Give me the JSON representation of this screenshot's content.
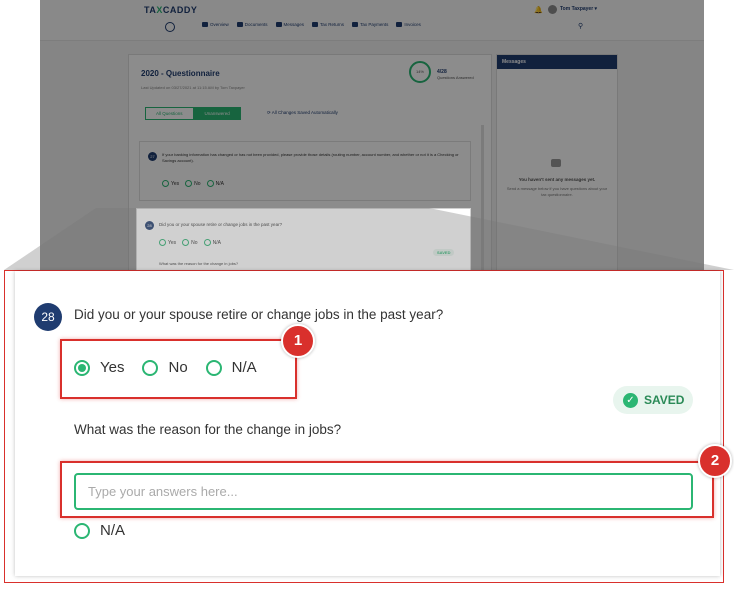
{
  "app": {
    "logo_pre": "TA",
    "logo_x": "X",
    "logo_post": "CADDY",
    "user_name": "Tom Taxpayer ▾"
  },
  "nav": {
    "items": [
      "Overview",
      "Documents",
      "Messages",
      "Tax Returns",
      "Tax Payments",
      "Invoices"
    ]
  },
  "questionnaire": {
    "title": "2020 - Questionnaire",
    "last_updated": "Last Updated on 03/27/2021 at 11:15 AM by Tom Taxpayer",
    "progress_percent_label": "14%",
    "answered_count": "4/28",
    "answered_label": "Questions Answered",
    "tabs": [
      "All Questions",
      "Unanswered"
    ],
    "autosave_text": "All Changes Saved Automatically"
  },
  "question27": {
    "number": "27",
    "text": "If your banking information has changed or has not been provided, please provide those details (routing number, account number, and whether or not it is a Checking or Savings account).",
    "options": [
      "Yes",
      "No",
      "N/A"
    ]
  },
  "messages": {
    "header": "Messages",
    "empty_title": "You haven't sent any messages yet.",
    "empty_sub": "Send a message below if you have questions about your tax questionnaire."
  },
  "question28": {
    "number": "28",
    "text": "Did you or your spouse retire or change jobs in the past year?",
    "options": [
      "Yes",
      "No",
      "N/A"
    ],
    "selected": "Yes",
    "saved_label": "SAVED",
    "followup_label": "What was the reason for the change in jobs?",
    "answer_placeholder": "Type your answers here...",
    "answer_value": "",
    "followup_na": "N/A"
  },
  "callouts": [
    "1",
    "2"
  ],
  "colors": {
    "accent_green": "#2bb673",
    "brand_navy": "#1f3c70",
    "highlight_red": "#d9302c"
  }
}
